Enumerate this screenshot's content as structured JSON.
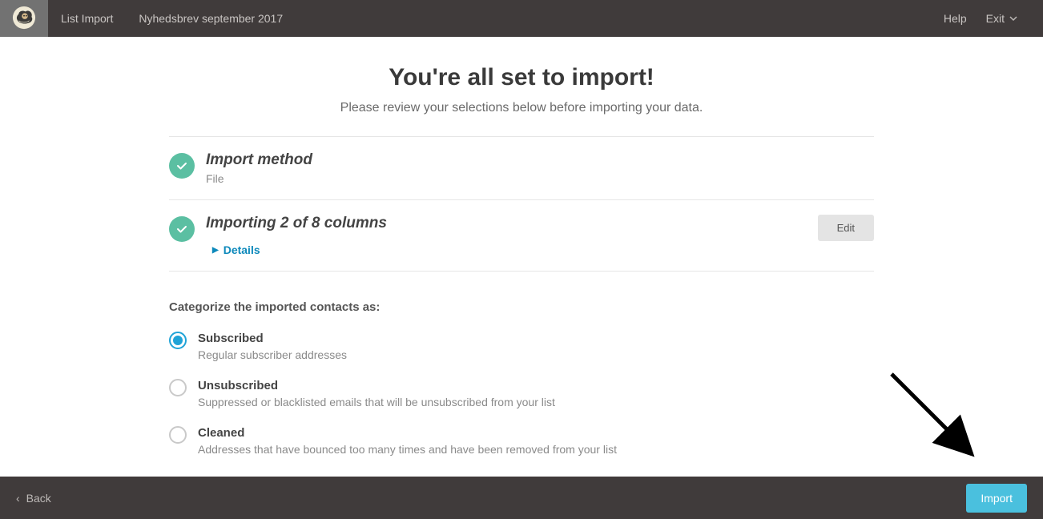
{
  "topbar": {
    "page_label": "List Import",
    "list_name": "Nyhedsbrev september 2017",
    "help_label": "Help",
    "exit_label": "Exit"
  },
  "header": {
    "title": "You're all set to import!",
    "subtitle": "Please review your selections below before importing your data."
  },
  "sections": {
    "import_method": {
      "title": "Import method",
      "value": "File"
    },
    "columns": {
      "title": "Importing 2 of 8 columns",
      "details_label": "Details",
      "edit_label": "Edit"
    }
  },
  "categorize": {
    "heading": "Categorize the imported contacts as:",
    "options": [
      {
        "label": "Subscribed",
        "description": "Regular subscriber addresses",
        "selected": true
      },
      {
        "label": "Unsubscribed",
        "description": "Suppressed or blacklisted emails that will be unsubscribed from your list",
        "selected": false
      },
      {
        "label": "Cleaned",
        "description": "Addresses that have bounced too many times and have been removed from your list",
        "selected": false
      }
    ]
  },
  "bottombar": {
    "back_label": "Back",
    "import_label": "Import"
  }
}
